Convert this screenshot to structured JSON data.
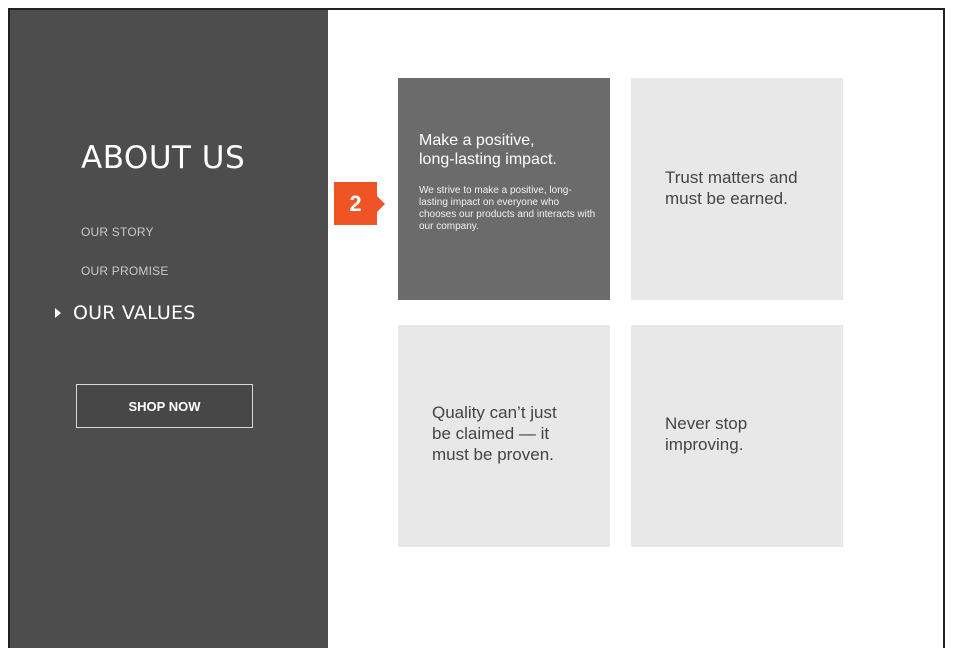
{
  "sidebar": {
    "title": "ABOUT US",
    "nav": [
      {
        "label": "OUR STORY",
        "active": false
      },
      {
        "label": "OUR PROMISE",
        "active": false
      },
      {
        "label": "OUR VALUES",
        "active": true
      }
    ],
    "shop_button": "SHOP NOW"
  },
  "cards": [
    {
      "heading": "Make a positive,\nlong-lasting impact.",
      "body": "We strive to make a positive, long-lasting impact on everyone who chooses our products and interacts with our company.",
      "expanded": true
    },
    {
      "heading": "Trust matters and\nmust be earned.",
      "expanded": false
    },
    {
      "heading": "Quality can’t just\nbe claimed — it\nmust be proven.",
      "expanded": false
    },
    {
      "heading": "Never stop\nimproving.",
      "expanded": false
    }
  ],
  "annotation": {
    "step": "2",
    "color": "#ef5426"
  },
  "colors": {
    "sidebar_bg": "#4d4d4d",
    "card_active_bg": "#6b6b6b",
    "card_bg": "#e8e8e8",
    "accent": "#ef5426"
  }
}
